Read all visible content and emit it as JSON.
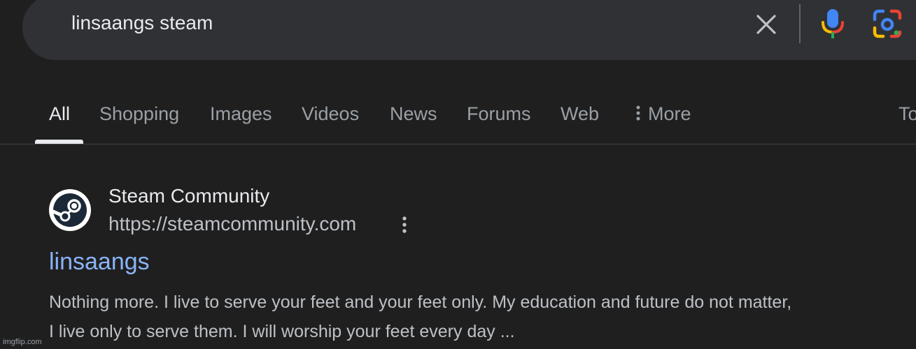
{
  "search": {
    "query": "linsaangs steam"
  },
  "tabs": [
    {
      "label": "All",
      "active": true
    },
    {
      "label": "Shopping"
    },
    {
      "label": "Images"
    },
    {
      "label": "Videos"
    },
    {
      "label": "News"
    },
    {
      "label": "Forums"
    },
    {
      "label": "Web"
    },
    {
      "label": "More"
    },
    {
      "label": "To"
    }
  ],
  "result": {
    "site_name": "Steam Community",
    "url": "https://steamcommunity.com",
    "title": "linsaangs",
    "snippet_line1": "Nothing more. I live to serve your feet and your feet only. My education and future do not matter,",
    "snippet_line2": "I live only to serve them. I will worship your feet every day ..."
  },
  "watermark": "imgflip.com",
  "icons": {
    "clear": "close-icon",
    "mic": "mic-icon",
    "lens": "google-lens-icon",
    "search": "search-icon",
    "more": "vertical-dots-icon",
    "favicon": "steam-logo-icon",
    "result_menu": "vertical-dots-icon"
  },
  "colors": {
    "background": "#1f1f1f",
    "search_bar": "#303134",
    "link": "#8ab4f8",
    "text": "#e8eaed",
    "muted": "#9aa0a6"
  }
}
